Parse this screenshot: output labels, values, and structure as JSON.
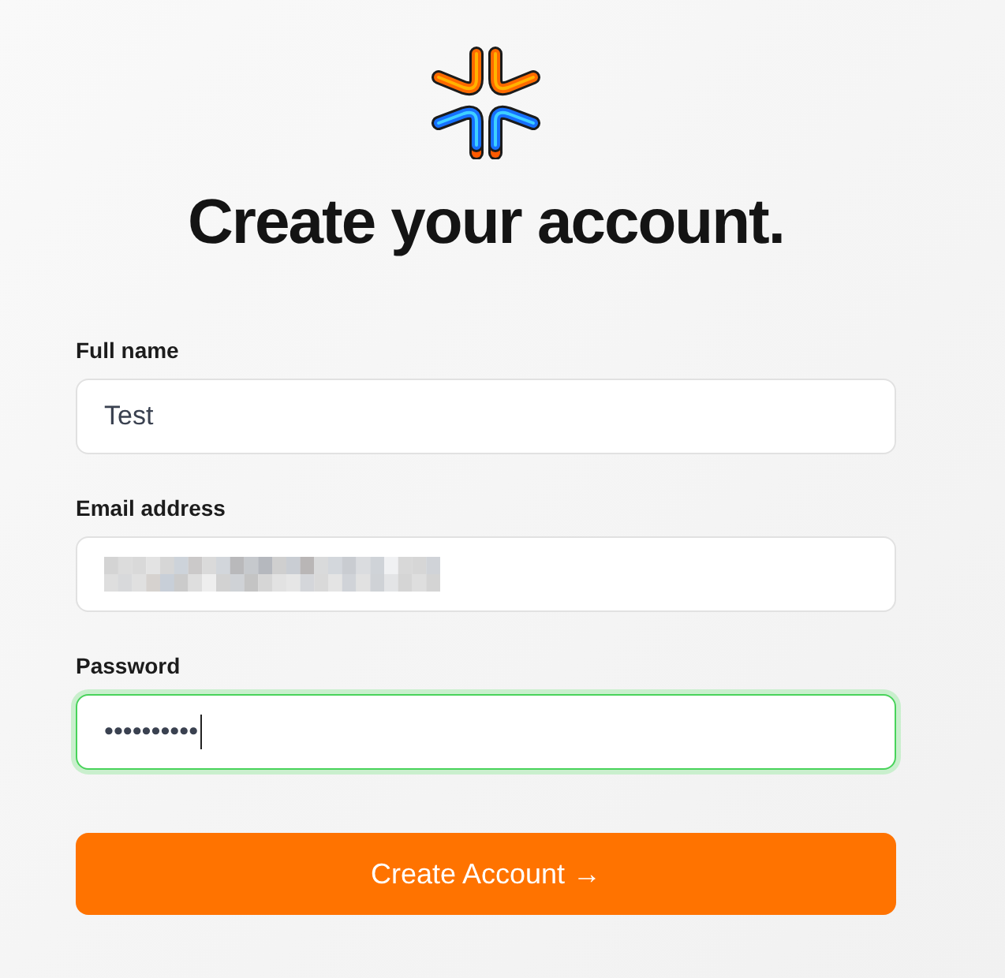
{
  "title": "Create your account.",
  "fields": [
    {
      "label": "Full name",
      "value": "Test",
      "redacted": false,
      "focused": false
    },
    {
      "label": "Email address",
      "redacted": true,
      "focused": false
    },
    {
      "label": "Password",
      "value": "••••••••••",
      "redacted": false,
      "focused": true
    }
  ],
  "submit_button": {
    "label": "Create Account →"
  }
}
